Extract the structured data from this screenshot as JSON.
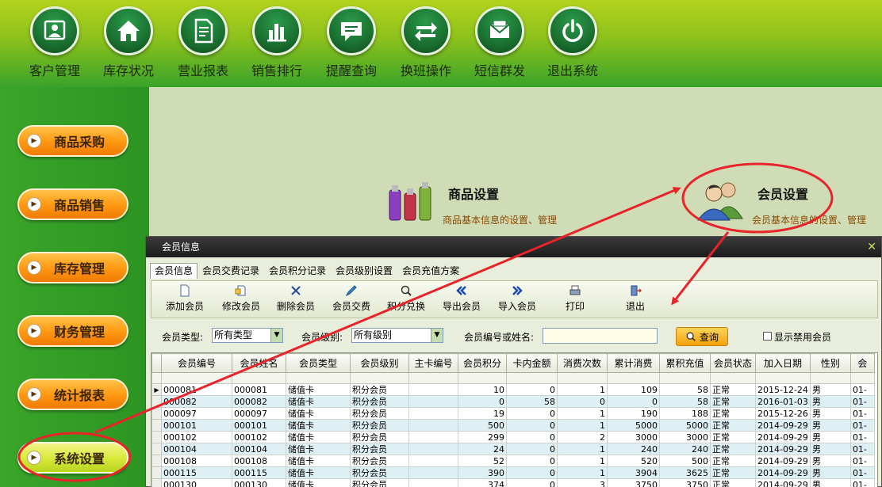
{
  "top_menu": [
    {
      "label": "客户管理",
      "icon": "customer-icon"
    },
    {
      "label": "库存状况",
      "icon": "home-icon"
    },
    {
      "label": "营业报表",
      "icon": "report-icon"
    },
    {
      "label": "销售排行",
      "icon": "bar-chart-icon"
    },
    {
      "label": "提醒查询",
      "icon": "speech-bubble-icon"
    },
    {
      "label": "换班操作",
      "icon": "swap-arrows-icon"
    },
    {
      "label": "短信群发",
      "icon": "envelope-icon"
    },
    {
      "label": "退出系统",
      "icon": "power-icon"
    }
  ],
  "side_menu": [
    {
      "label": "商品采购",
      "active": false
    },
    {
      "label": "商品销售",
      "active": false
    },
    {
      "label": "库存管理",
      "active": false
    },
    {
      "label": "财务管理",
      "active": false
    },
    {
      "label": "统计报表",
      "active": false
    },
    {
      "label": "系统设置",
      "active": true
    }
  ],
  "main": {
    "product_settings": {
      "title": "商品设置",
      "desc": "商品基本信息的设置、管理"
    },
    "member_settings": {
      "title": "会员设置",
      "desc": "会员基本信息的设置、管理"
    }
  },
  "dialog": {
    "title": "会员信息",
    "close_icon": "close-icon",
    "tabs": [
      {
        "label": "会员信息",
        "active": true
      },
      {
        "label": "会员交费记录",
        "active": false
      },
      {
        "label": "会员积分记录",
        "active": false
      },
      {
        "label": "会员级别设置",
        "active": false
      },
      {
        "label": "会员充值方案",
        "active": false
      }
    ],
    "toolbar": [
      {
        "label": "添加会员",
        "icon": "add-document-icon"
      },
      {
        "label": "修改会员",
        "icon": "edit-document-icon"
      },
      {
        "label": "删除会员",
        "icon": "delete-x-icon"
      },
      {
        "label": "会员交费",
        "icon": "pen-icon"
      },
      {
        "label": "积分兑换",
        "icon": "magnifier-icon"
      },
      {
        "label": "导出会员",
        "icon": "double-left-arrow-icon"
      },
      {
        "label": "导入会员",
        "icon": "double-right-arrow-icon"
      },
      {
        "label": "打印",
        "icon": "printer-icon"
      },
      {
        "label": "退出",
        "icon": "exit-door-icon"
      }
    ],
    "filters": {
      "type_label": "会员类型:",
      "type_value": "所有类型",
      "level_label": "会员级别:",
      "level_value": "所有级别",
      "search_label": "会员编号或姓名:",
      "search_value": "",
      "query_button": "查询",
      "show_disabled_label": "显示禁用会员",
      "show_disabled_checked": false
    },
    "table": {
      "columns": [
        "会员编号",
        "会员姓名",
        "会员类型",
        "会员级别",
        "主卡编号",
        "会员积分",
        "卡内金额",
        "消费次数",
        "累计消费",
        "累积充值",
        "会员状态",
        "加入日期",
        "性别",
        "会"
      ],
      "rows": [
        [
          "000081",
          "000081",
          "储值卡",
          "积分会员",
          "",
          "10",
          "0",
          "1",
          "109",
          "58",
          "正常",
          "2015-12-24",
          "男",
          "01-"
        ],
        [
          "000082",
          "000082",
          "储值卡",
          "积分会员",
          "",
          "0",
          "58",
          "0",
          "0",
          "58",
          "正常",
          "2016-01-03",
          "男",
          "01-"
        ],
        [
          "000097",
          "000097",
          "储值卡",
          "积分会员",
          "",
          "19",
          "0",
          "1",
          "190",
          "188",
          "正常",
          "2015-12-26",
          "男",
          "01-"
        ],
        [
          "000101",
          "000101",
          "储值卡",
          "积分会员",
          "",
          "500",
          "0",
          "1",
          "5000",
          "5000",
          "正常",
          "2014-09-29",
          "男",
          "01-"
        ],
        [
          "000102",
          "000102",
          "储值卡",
          "积分会员",
          "",
          "299",
          "0",
          "2",
          "3000",
          "3000",
          "正常",
          "2014-09-29",
          "男",
          "01-"
        ],
        [
          "000104",
          "000104",
          "储值卡",
          "积分会员",
          "",
          "24",
          "0",
          "1",
          "240",
          "240",
          "正常",
          "2014-09-29",
          "男",
          "01-"
        ],
        [
          "000108",
          "000108",
          "储值卡",
          "积分会员",
          "",
          "52",
          "0",
          "1",
          "520",
          "500",
          "正常",
          "2014-09-29",
          "男",
          "01-"
        ],
        [
          "000115",
          "000115",
          "储值卡",
          "积分会员",
          "",
          "390",
          "0",
          "1",
          "3904",
          "3625",
          "正常",
          "2014-09-29",
          "男",
          "01-"
        ],
        [
          "000130",
          "000130",
          "储值卡",
          "积分会员",
          "",
          "374",
          "0",
          "3",
          "3750",
          "3750",
          "正常",
          "2014-09-29",
          "男",
          "01-"
        ]
      ]
    }
  },
  "colors": {
    "annotation_red": "#e8232a",
    "accent_orange": "#f5a10a",
    "brand_green": "#2e9a23"
  }
}
